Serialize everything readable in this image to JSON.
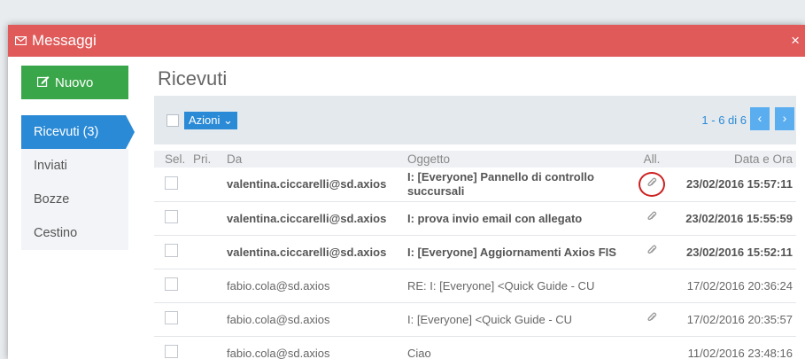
{
  "window": {
    "title": "Messaggi",
    "close_label": "×"
  },
  "sidebar": {
    "new_button_label": "Nuovo",
    "folders": [
      {
        "label": "Ricevuti (3)"
      },
      {
        "label": "Inviati"
      },
      {
        "label": "Bozze"
      },
      {
        "label": "Cestino"
      }
    ]
  },
  "main": {
    "title": "Ricevuti",
    "toolbar": {
      "actions_label": "Azioni ⌄",
      "pagination": "1 - 6 di 6",
      "prev": "‹",
      "next": "›"
    },
    "columns": {
      "sel": "Sel.",
      "pri": "Pri.",
      "from": "Da",
      "subject": "Oggetto",
      "attach": "All.",
      "date": "Data e Ora"
    },
    "rows": [
      {
        "from": "valentina.ciccarelli@sd.axios",
        "subject": "I: [Everyone] Pannello di controllo succursali",
        "date": "23/02/2016 15:57:11"
      },
      {
        "from": "valentina.ciccarelli@sd.axios",
        "subject": "I: prova invio email con allegato",
        "date": "23/02/2016 15:55:59"
      },
      {
        "from": "valentina.ciccarelli@sd.axios",
        "subject": "I: [Everyone] Aggiornamenti Axios FIS",
        "date": "23/02/2016 15:52:11"
      },
      {
        "from": "fabio.cola@sd.axios",
        "subject": "RE: I: [Everyone] <Quick Guide - CU",
        "date": "17/02/2016 20:36:24"
      },
      {
        "from": "fabio.cola@sd.axios",
        "subject": "I: [Everyone] <Quick Guide - CU",
        "date": "17/02/2016 20:35:57"
      },
      {
        "from": "fabio.cola@sd.axios",
        "subject": "Ciao",
        "date": "11/02/2016 23:48:16"
      }
    ]
  },
  "colors": {
    "titlebar": "#e05a5a",
    "new_button": "#3aa64a",
    "active_folder": "#2a8ad6"
  },
  "icons": {
    "titlebar": "envelope-icon",
    "new_button": "edit-icon",
    "attachment": "paperclip-icon"
  }
}
